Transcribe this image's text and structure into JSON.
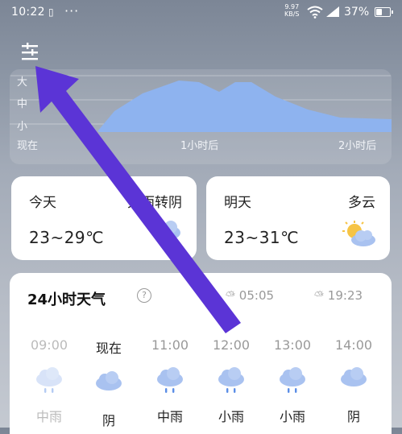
{
  "status_bar": {
    "time": "10:22",
    "network_speed_value": "9.97",
    "network_speed_unit": "KB/S",
    "battery_text": "37%",
    "battery_level": 0.37
  },
  "precipitation": {
    "levels": [
      "大",
      "中",
      "小"
    ],
    "ticks": [
      "现在",
      "1小时后",
      "2小时后"
    ],
    "fill_color": "#8eb3ef"
  },
  "today": {
    "label": "今天",
    "condition": "大雨转阴",
    "temp": "23~29℃",
    "icon": "rain-cloud-icon"
  },
  "tomorrow": {
    "label": "明天",
    "condition": "多云",
    "temp": "23~31℃",
    "icon": "sun-cloud-icon"
  },
  "hourly": {
    "title": "24小时天气",
    "sunrise": "05:05",
    "sunset": "19:23",
    "hours": [
      {
        "time": "09:00",
        "cond": "中雨",
        "icon": "rain-cloud-icon"
      },
      {
        "time": "现在",
        "cond": "阴",
        "icon": "cloud-icon"
      },
      {
        "time": "11:00",
        "cond": "中雨",
        "icon": "rain-cloud-icon"
      },
      {
        "time": "12:00",
        "cond": "小雨",
        "icon": "rain-cloud-icon"
      },
      {
        "time": "13:00",
        "cond": "小雨",
        "icon": "rain-cloud-icon"
      },
      {
        "time": "14:00",
        "cond": "阴",
        "icon": "cloud-icon"
      }
    ]
  },
  "colors": {
    "annotation_arrow": "#5b34d6",
    "cloud": "#a9c2f0"
  }
}
